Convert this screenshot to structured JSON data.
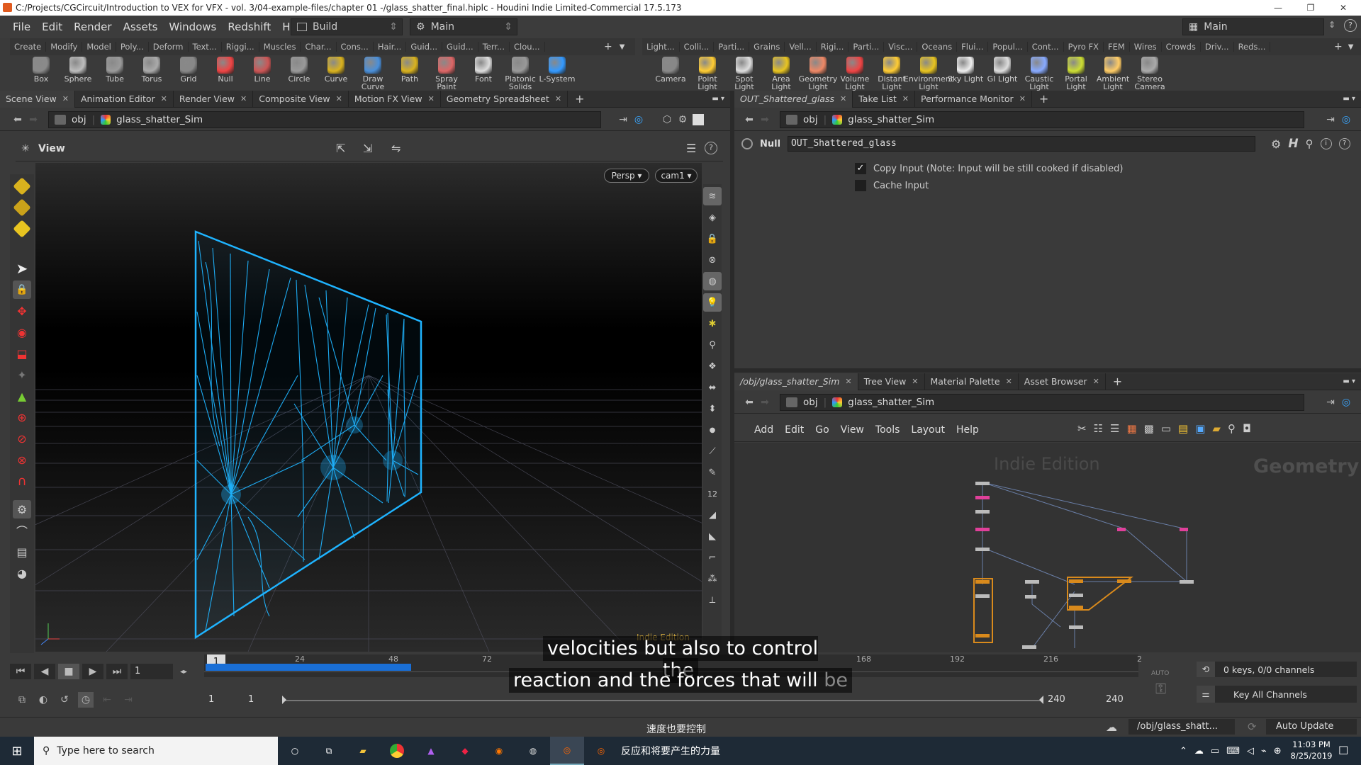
{
  "window": {
    "title": "C:/Projects/CGCircuit/Introduction to VEX for VFX - vol. 3/04-example-files/chapter 01 -/glass_shatter_final.hiplc - Houdini Indie Limited-Commercial 17.5.173"
  },
  "menu": [
    "File",
    "Edit",
    "Render",
    "Assets",
    "Windows",
    "Redshift",
    "Help"
  ],
  "desktop": {
    "build_label": "Build",
    "main_label": "Main",
    "main_right": "Main"
  },
  "shelf_tabs_left": [
    "Create",
    "Modify",
    "Model",
    "Poly...",
    "Deform",
    "Text...",
    "Riggi...",
    "Muscles",
    "Char...",
    "Cons...",
    "Hair...",
    "Guid...",
    "Guid...",
    "Terr...",
    "Clou..."
  ],
  "shelf_tabs_right": [
    "Light...",
    "Colli...",
    "Parti...",
    "Grains",
    "Vell...",
    "Rigi...",
    "Parti...",
    "Visc...",
    "Oceans",
    "Flui...",
    "Popul...",
    "Cont...",
    "Pyro FX",
    "FEM",
    "Wires",
    "Crowds",
    "Driv...",
    "Reds..."
  ],
  "tools_left": [
    "Box",
    "Sphere",
    "Tube",
    "Torus",
    "Grid",
    "Null",
    "Line",
    "Circle",
    "Curve",
    "Draw Curve",
    "Path",
    "Spray Paint",
    "Font",
    "Platonic Solids",
    "L-System"
  ],
  "tools_right": [
    "Camera",
    "Point Light",
    "Spot Light",
    "Area Light",
    "Geometry Light",
    "Volume Light",
    "Distant Light",
    "Environment Light",
    "Sky Light",
    "GI Light",
    "Caustic Light",
    "Portal Light",
    "Ambient Light",
    "Stereo Camera"
  ],
  "left_pane_tabs": [
    "Scene View",
    "Animation Editor",
    "Render View",
    "Composite View",
    "Motion FX View",
    "Geometry Spreadsheet"
  ],
  "path": {
    "obj": "obj",
    "node": "glass_shatter_Sim"
  },
  "viewport": {
    "label": "View",
    "persp": "Persp",
    "cam": "cam1",
    "watermark": "Indie Edition",
    "side_num": "12"
  },
  "param_tabs": [
    "OUT_Shattered_glass",
    "Take List",
    "Performance Monitor"
  ],
  "params": {
    "node_type": "Null",
    "node_name": "OUT_Shattered_glass",
    "copy_input": "Copy Input (Note: Input will be still cooked if disabled)",
    "cache_input": "Cache Input"
  },
  "net_tabs": [
    "/obj/glass_shatter_Sim",
    "Tree View",
    "Material Palette",
    "Asset Browser"
  ],
  "net_menu": [
    "Add",
    "Edit",
    "Go",
    "View",
    "Tools",
    "Layout",
    "Help"
  ],
  "network": {
    "watermark": "Indie Edition",
    "context": "Geometry"
  },
  "timeline": {
    "frame": "1",
    "current_marker": "1",
    "ticks": [
      "24",
      "48",
      "72",
      "168",
      "192",
      "216",
      "2"
    ],
    "start": "1",
    "start2": "1",
    "end": "240",
    "end2": "240",
    "keys": "0 keys, 0/0 channels",
    "key_all": "Key All Channels",
    "auto_label": "AUTO"
  },
  "status": {
    "path": "/obj/glass_shatt...",
    "auto_update": "Auto Update"
  },
  "subtitles": {
    "line1": "velocities but also to control the",
    "line2a": "reaction and the forces that will ",
    "line2b": "be",
    "chinese_bottom": "速度也要控制",
    "chinese_taskbar": "反应和将要产生的力量"
  },
  "taskbar": {
    "search_placeholder": "Type here to search",
    "time": "11:03 PM",
    "date": "8/25/2019"
  },
  "colors": {
    "wire": "#1fb4ff",
    "accent": "#1a6fd6",
    "orange": "#d98a1c",
    "pink": "#e0409a"
  }
}
